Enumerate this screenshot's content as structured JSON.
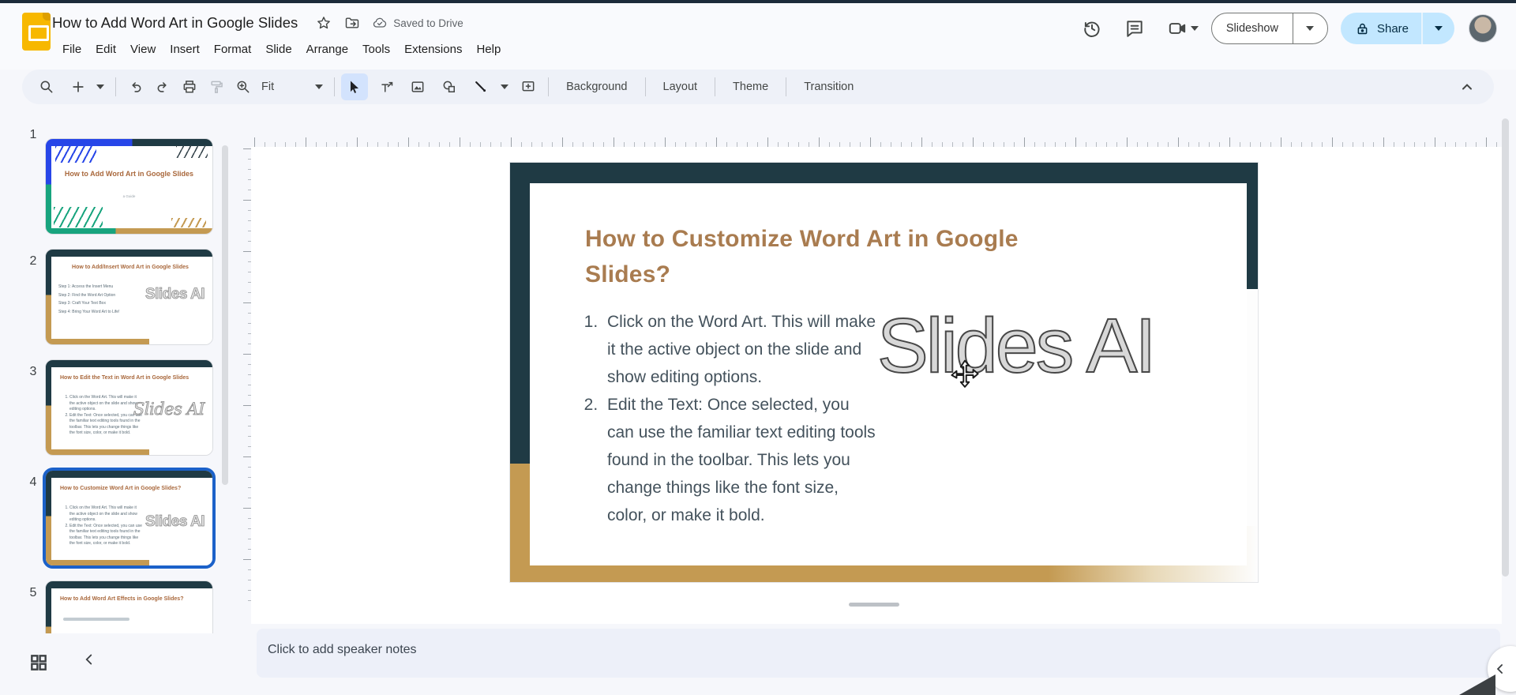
{
  "header": {
    "title": "How to Add Word Art in Google Slides",
    "saved_status": "Saved to Drive",
    "menus": [
      "File",
      "Edit",
      "View",
      "Insert",
      "Format",
      "Slide",
      "Arrange",
      "Tools",
      "Extensions",
      "Help"
    ],
    "slideshow_label": "Slideshow",
    "share_label": "Share"
  },
  "toolbar": {
    "zoom_value": "Fit",
    "background_label": "Background",
    "layout_label": "Layout",
    "theme_label": "Theme",
    "transition_label": "Transition"
  },
  "filmstrip": {
    "slides": [
      {
        "number": "1",
        "title": "How to Add Word Art in Google Slides",
        "subtitle": "a Guide"
      },
      {
        "number": "2",
        "title": "How to Add/Insert Word Art in Google Slides",
        "steps": [
          "Step 1: Access the Insert Menu",
          "Step 2: Find the Word Art Option",
          "Step 3: Craft Your Text Box",
          "Step 4: Bring Your Word Art to Life!"
        ],
        "wordart": "Slides AI"
      },
      {
        "number": "3",
        "title": "How to Edit the Text in Word Art in Google Slides",
        "wordart": "Slides AI"
      },
      {
        "number": "4",
        "title": "How to Customize Word Art in Google Slides?",
        "wordart": "Slides AI"
      },
      {
        "number": "5",
        "title": "How to Add Word Art Effects in Google Slides?"
      }
    ]
  },
  "canvas": {
    "slide_title": "How to Customize Word Art in Google Slides?",
    "list": [
      "Click on the Word Art. This will make it the active object on the slide and show editing options.",
      "Edit the Text: Once selected, you can use the familiar text editing tools found in the toolbar. This lets you change things like the font size, color, or make it bold."
    ],
    "wordart_text": "Slides AI"
  },
  "notes": {
    "placeholder": "Click to add speaker notes"
  },
  "colors": {
    "share_bg": "#c2e7ff",
    "selected_thumb_border": "#1b61c9",
    "slide_dark_teal": "#1f3a44",
    "slide_gold": "#c49a52",
    "slide_title_tan": "#a97c50",
    "slide_body_text": "#44525c",
    "wordart_fill": "#d8d8d8",
    "logo_yellow": "#f7b800"
  }
}
